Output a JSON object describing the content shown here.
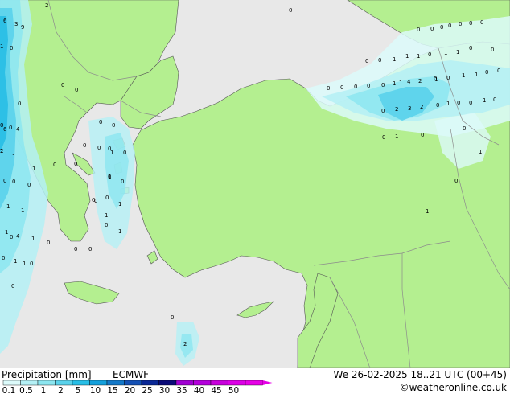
{
  "map": {
    "title": "Precipitation [mm]",
    "model": "ECMWF",
    "valid_time": "We 26-02-2025 18..21 UTC (00+45)",
    "credit": "©weatheronline.co.uk",
    "colors": {
      "sea": "#e8e8e8",
      "land": "#b4ef90",
      "border": "#8c8c8c",
      "coast": "#555555"
    },
    "legend": {
      "ticks": [
        "0.1",
        "0.5",
        "1",
        "2",
        "5",
        "10",
        "15",
        "20",
        "25",
        "30",
        "35",
        "40",
        "45",
        "50"
      ],
      "colors": [
        "#dcfafa",
        "#b4f0f5",
        "#8ce6f0",
        "#5ad2eb",
        "#28bee6",
        "#14a0dc",
        "#1478c8",
        "#1450b4",
        "#0a2896",
        "#0a0a78",
        "#a000d2",
        "#b400dc",
        "#c800dc",
        "#dc00e6",
        "#e600e6"
      ]
    },
    "point_values": [
      {
        "v": "2"
      },
      {
        "v": "0"
      },
      {
        "v": "6"
      },
      {
        "v": "3"
      },
      {
        "v": "9"
      },
      {
        "v": "1"
      },
      {
        "v": "0"
      },
      {
        "v": "0"
      },
      {
        "v": "0"
      },
      {
        "v": "0"
      },
      {
        "v": "0"
      },
      {
        "v": "0"
      },
      {
        "v": "0"
      },
      {
        "v": "0"
      },
      {
        "v": "4"
      },
      {
        "v": "6"
      },
      {
        "v": "0"
      },
      {
        "v": "0"
      },
      {
        "v": "1"
      },
      {
        "v": "0"
      },
      {
        "v": "1"
      },
      {
        "v": "2"
      },
      {
        "v": "1"
      },
      {
        "v": "0"
      },
      {
        "v": "0"
      },
      {
        "v": "1"
      },
      {
        "v": "0"
      },
      {
        "v": "0"
      },
      {
        "v": "1"
      },
      {
        "v": "0"
      },
      {
        "v": "0"
      },
      {
        "v": "0"
      },
      {
        "v": "1"
      },
      {
        "v": "0"
      },
      {
        "v": "1"
      },
      {
        "v": "1"
      },
      {
        "v": "4"
      },
      {
        "v": "1"
      },
      {
        "v": "0"
      },
      {
        "v": "0"
      },
      {
        "v": "1"
      },
      {
        "v": "0"
      },
      {
        "v": "1"
      },
      {
        "v": "1"
      },
      {
        "v": "0"
      },
      {
        "v": "0"
      },
      {
        "v": "1"
      },
      {
        "v": "0"
      },
      {
        "v": "0"
      },
      {
        "v": "0"
      },
      {
        "v": "0"
      },
      {
        "v": "0"
      },
      {
        "v": "0"
      },
      {
        "v": "1"
      },
      {
        "v": "0"
      },
      {
        "v": "2"
      },
      {
        "v": "0"
      },
      {
        "v": "0"
      },
      {
        "v": "0"
      },
      {
        "v": "0"
      },
      {
        "v": "0"
      },
      {
        "v": "0"
      },
      {
        "v": "0"
      },
      {
        "v": "1"
      },
      {
        "v": "1"
      },
      {
        "v": "0"
      },
      {
        "v": "1"
      },
      {
        "v": "1"
      },
      {
        "v": "0"
      },
      {
        "v": "0"
      },
      {
        "v": "1"
      },
      {
        "v": "0"
      },
      {
        "v": "0"
      },
      {
        "v": "0"
      },
      {
        "v": "1"
      },
      {
        "v": "1"
      },
      {
        "v": "0"
      },
      {
        "v": "0"
      },
      {
        "v": "0"
      },
      {
        "v": "0"
      },
      {
        "v": "0"
      },
      {
        "v": "0"
      },
      {
        "v": "1"
      },
      {
        "v": "1"
      },
      {
        "v": "4"
      },
      {
        "v": "2"
      },
      {
        "v": "1"
      },
      {
        "v": "0"
      },
      {
        "v": "0"
      },
      {
        "v": "1"
      },
      {
        "v": "0"
      },
      {
        "v": "0"
      },
      {
        "v": "2"
      },
      {
        "v": "3"
      },
      {
        "v": "2"
      },
      {
        "v": "1"
      },
      {
        "v": "0"
      },
      {
        "v": "0"
      },
      {
        "v": "0"
      },
      {
        "v": "0"
      },
      {
        "v": "0"
      },
      {
        "v": "1"
      },
      {
        "v": "0"
      },
      {
        "v": "1"
      },
      {
        "v": "0"
      },
      {
        "v": "1"
      },
      {
        "v": "1"
      },
      {
        "v": "0"
      }
    ]
  }
}
